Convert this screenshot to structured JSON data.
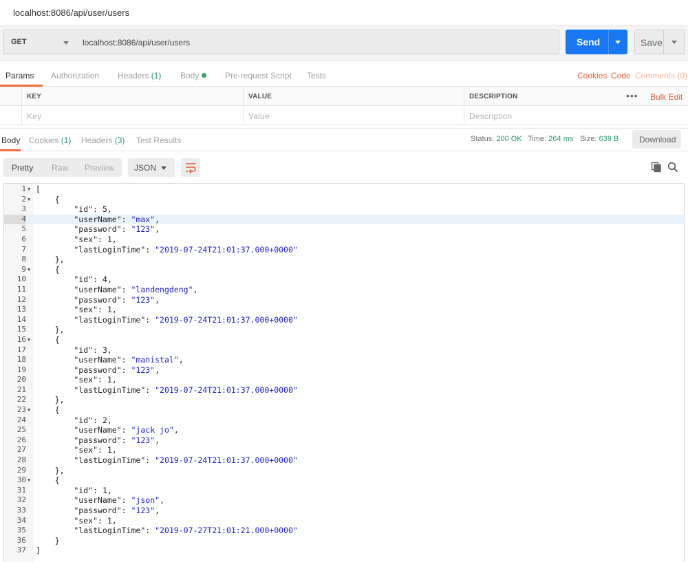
{
  "window": {
    "tab_title": "localhost:8086/api/user/users"
  },
  "request": {
    "method": "GET",
    "url": "localhost:8086/api/user/users",
    "send_label": "Send",
    "save_label": "Save"
  },
  "request_tabs": {
    "params": "Params",
    "authorization": "Authorization",
    "headers": "Headers",
    "headers_count": "(1)",
    "body": "Body",
    "prerequest": "Pre-request Script",
    "tests": "Tests",
    "cookies": "Cookies",
    "code": "Code",
    "comments": "Comments (0)"
  },
  "params_table": {
    "columns": [
      "KEY",
      "VALUE",
      "DESCRIPTION"
    ],
    "placeholders": [
      "Key",
      "Value",
      "Description"
    ],
    "more": "•••",
    "bulk_edit": "Bulk Edit"
  },
  "response_tabs": {
    "body": "Body",
    "cookies": "Cookies",
    "cookies_count": "(1)",
    "headers": "Headers",
    "headers_count": "(3)",
    "test_results": "Test Results"
  },
  "response_meta": {
    "status_label": "Status:",
    "status_value": "200 OK",
    "time_label": "Time:",
    "time_value": "264 ms",
    "size_label": "Size:",
    "size_value": "639 B",
    "download_label": "Download"
  },
  "view_modes": {
    "pretty": "Pretty",
    "raw": "Raw",
    "preview": "Preview",
    "format": "JSON"
  },
  "colors": {
    "accent_orange": "#f26b3a",
    "send_blue": "#1877f2",
    "status_green": "#2d9b6d"
  },
  "icons": [
    "chevron-down-icon",
    "wrap-lines-icon",
    "copy-icon",
    "search-icon",
    "fold-arrow-icon"
  ],
  "response_body": {
    "highlighted_line": 4,
    "users": [
      {
        "id": 5,
        "userName": "max",
        "password": "123",
        "sex": 1,
        "lastLoginTime": "2019-07-24T21:01:37.000+0000"
      },
      {
        "id": 4,
        "userName": "landengdeng",
        "password": "123",
        "sex": 1,
        "lastLoginTime": "2019-07-24T21:01:37.000+0000"
      },
      {
        "id": 3,
        "userName": "manistal",
        "password": "123",
        "sex": 1,
        "lastLoginTime": "2019-07-24T21:01:37.000+0000"
      },
      {
        "id": 2,
        "userName": "jack jo",
        "password": "123",
        "sex": 1,
        "lastLoginTime": "2019-07-24T21:01:37.000+0000"
      },
      {
        "id": 1,
        "userName": "json",
        "password": "123",
        "sex": 1,
        "lastLoginTime": "2019-07-27T21:01:21.000+0000"
      }
    ]
  }
}
